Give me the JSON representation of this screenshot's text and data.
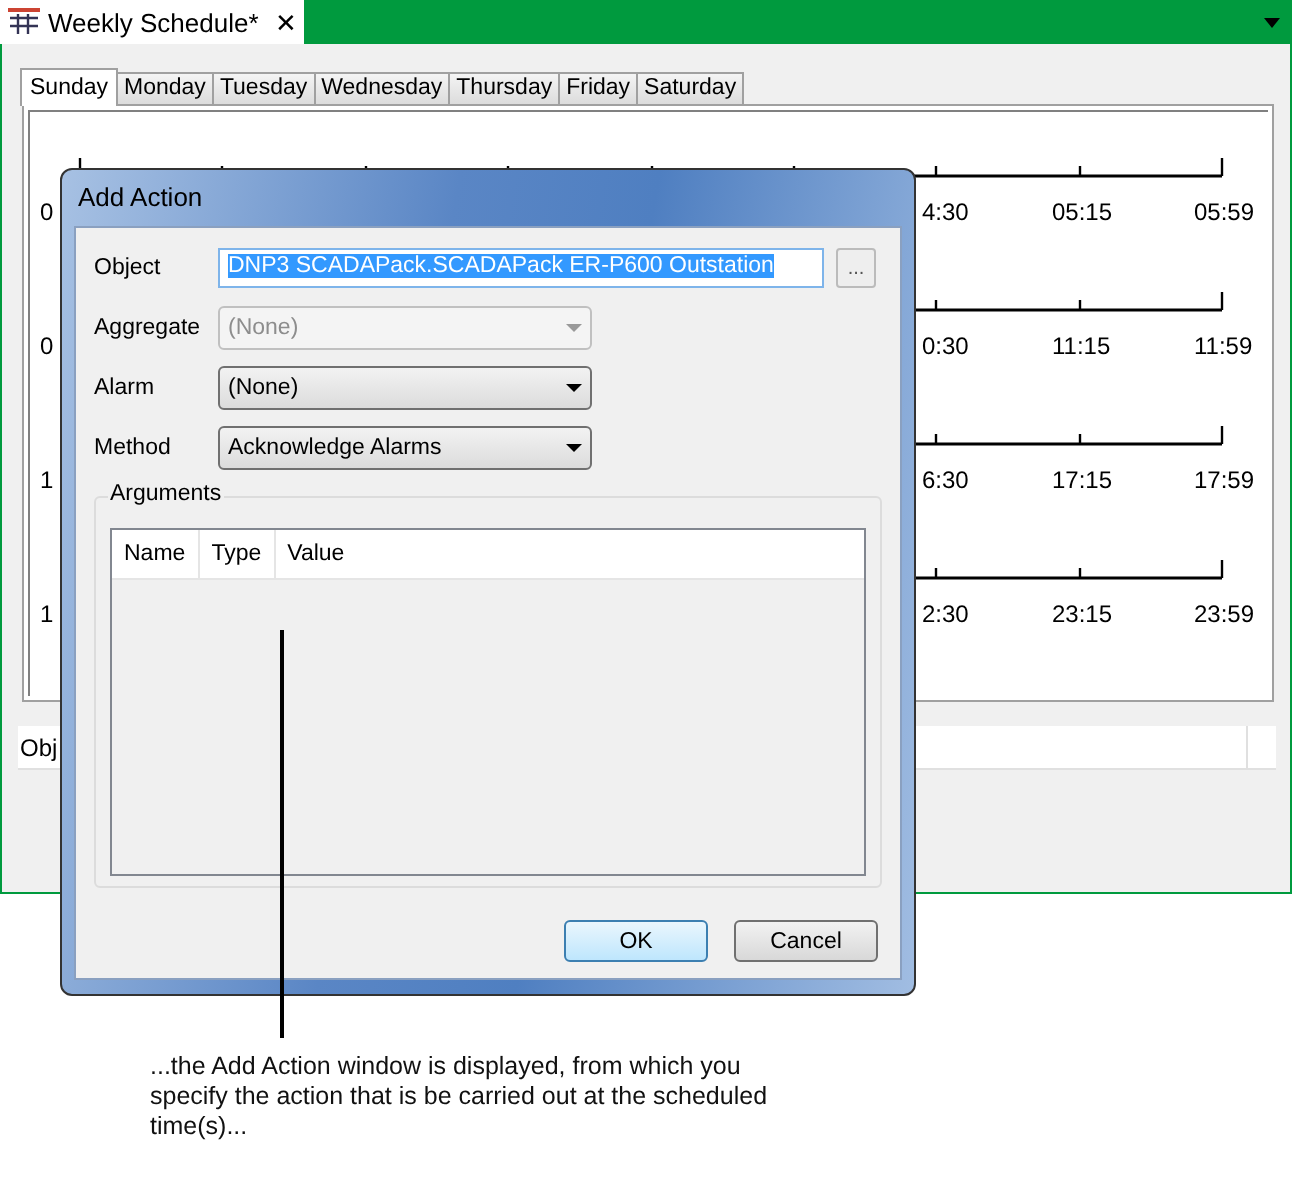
{
  "document_tab": {
    "title": "Weekly Schedule*",
    "close": "✕"
  },
  "day_tabs": [
    {
      "label": "Sunday",
      "selected": true
    },
    {
      "label": "Monday",
      "selected": false
    },
    {
      "label": "Tuesday",
      "selected": false
    },
    {
      "label": "Wednesday",
      "selected": false
    },
    {
      "label": "Thursday",
      "selected": false
    },
    {
      "label": "Friday",
      "selected": false
    },
    {
      "label": "Saturday",
      "selected": false
    }
  ],
  "timeline": {
    "rows": [
      {
        "start_label": "0",
        "labels": [
          "4:30",
          "05:15",
          "05:59"
        ]
      },
      {
        "start_label": "0",
        "labels": [
          "0:30",
          "11:15",
          "11:59"
        ]
      },
      {
        "start_label": "1",
        "labels": [
          "6:30",
          "17:15",
          "17:59"
        ]
      },
      {
        "start_label": "1",
        "labels": [
          "2:30",
          "23:15",
          "23:59"
        ]
      }
    ]
  },
  "object_list": {
    "column_1": "Obj"
  },
  "dialog": {
    "title": "Add Action",
    "fields": [
      {
        "label": "Object",
        "kind": "text",
        "value": "DNP3 SCADAPack.SCADAPack ER-P600 Outstation",
        "text_selected": true
      },
      {
        "label": "Aggregate",
        "kind": "combo",
        "value": "(None)",
        "disabled": true
      },
      {
        "label": "Alarm",
        "kind": "combo",
        "value": "(None)",
        "disabled": false
      },
      {
        "label": "Method",
        "kind": "combo",
        "value": "Acknowledge Alarms",
        "disabled": false
      }
    ],
    "browse_button": "...",
    "arguments": {
      "title": "Arguments",
      "columns": [
        "Name",
        "Type",
        "Value"
      ]
    },
    "buttons": [
      {
        "label": "OK",
        "default": true
      },
      {
        "label": "Cancel",
        "default": false
      }
    ]
  },
  "caption": "...the Add Action window is displayed, from which you specify the action that is be carried out at the scheduled time(s)..."
}
